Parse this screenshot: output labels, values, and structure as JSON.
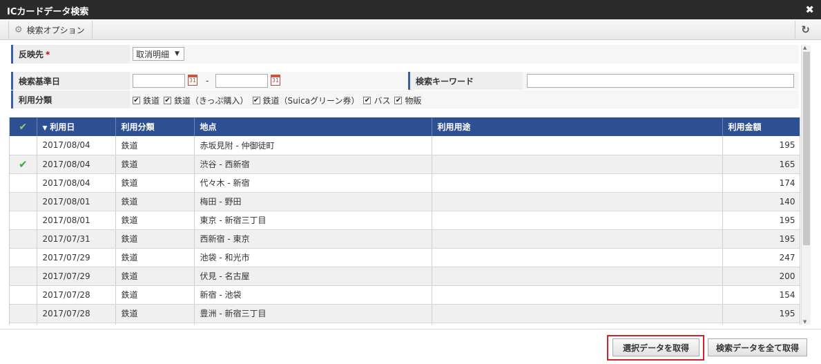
{
  "window": {
    "title": "ICカードデータ検索",
    "close_icon": "close-icon"
  },
  "toolbar": {
    "options_label": "検索オプション",
    "options_icon": "gear-icon",
    "refresh_icon": "refresh-icon"
  },
  "form": {
    "reflect_label": "反映先",
    "reflect_required": "*",
    "reflect_value": "取消明細",
    "date_label": "検索基準日",
    "date_from": "",
    "date_to": "",
    "date_separator": "-",
    "keyword_label": "検索キーワード",
    "keyword_value": "",
    "usage_label": "利用分類",
    "usage_options": [
      {
        "label": "鉄道",
        "checked": true
      },
      {
        "label": "鉄道（きっぷ購入）",
        "checked": true
      },
      {
        "label": "鉄道（Suicaグリーン券）",
        "checked": true
      },
      {
        "label": "バス",
        "checked": true
      },
      {
        "label": "物販",
        "checked": true
      }
    ]
  },
  "table": {
    "columns": [
      "利用日",
      "利用分類",
      "地点",
      "利用用途",
      "利用金額"
    ],
    "sort_indicator": "▼",
    "rows": [
      {
        "checked": false,
        "date": "2017/08/04",
        "category": "鉄道",
        "place": "赤坂見附 - 仲御徒町",
        "purpose": "",
        "amount": "195"
      },
      {
        "checked": true,
        "date": "2017/08/04",
        "category": "鉄道",
        "place": "渋谷 - 西新宿",
        "purpose": "",
        "amount": "165"
      },
      {
        "checked": false,
        "date": "2017/08/04",
        "category": "鉄道",
        "place": "代々木 - 新宿",
        "purpose": "",
        "amount": "174"
      },
      {
        "checked": false,
        "date": "2017/08/01",
        "category": "鉄道",
        "place": "梅田 - 野田",
        "purpose": "",
        "amount": "140"
      },
      {
        "checked": false,
        "date": "2017/08/01",
        "category": "鉄道",
        "place": "東京 - 新宿三丁目",
        "purpose": "",
        "amount": "195"
      },
      {
        "checked": false,
        "date": "2017/07/31",
        "category": "鉄道",
        "place": "西新宿 - 東京",
        "purpose": "",
        "amount": "195"
      },
      {
        "checked": false,
        "date": "2017/07/29",
        "category": "鉄道",
        "place": "池袋 - 和光市",
        "purpose": "",
        "amount": "247"
      },
      {
        "checked": false,
        "date": "2017/07/29",
        "category": "鉄道",
        "place": "伏見 - 名古屋",
        "purpose": "",
        "amount": "200"
      },
      {
        "checked": false,
        "date": "2017/07/28",
        "category": "鉄道",
        "place": "新宿 - 池袋",
        "purpose": "",
        "amount": "154"
      },
      {
        "checked": false,
        "date": "2017/07/28",
        "category": "鉄道",
        "place": "豊洲 - 新宿三丁目",
        "purpose": "",
        "amount": "195"
      },
      {
        "checked": false,
        "date": "",
        "category": "",
        "place": "",
        "purpose": "",
        "amount": ""
      }
    ]
  },
  "footer": {
    "get_selected_label": "選択データを取得",
    "get_all_label": "検索データを全て取得",
    "highlight_color": "#d0202a"
  }
}
